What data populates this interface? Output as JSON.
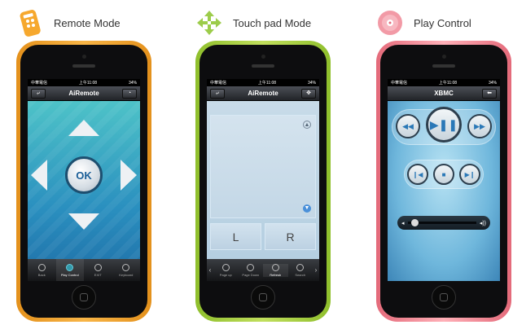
{
  "captions": {
    "remote": "Remote Mode",
    "touchpad": "Touch pad Mode",
    "play": "Play Control"
  },
  "status": {
    "carrier": "中華電信",
    "time": "上午11:08",
    "battery": "34%"
  },
  "remote": {
    "title": "AiRemote",
    "ok_label": "OK",
    "tabs": [
      {
        "label": "Back"
      },
      {
        "label": "Play Control"
      },
      {
        "label": "EXIT"
      },
      {
        "label": "Keyboard"
      }
    ]
  },
  "touchpad": {
    "title": "AiRemote",
    "left_label": "L",
    "right_label": "R",
    "tabs": [
      {
        "label": "Page up"
      },
      {
        "label": "Page Down"
      },
      {
        "label": "Refresh"
      },
      {
        "label": "Search"
      }
    ]
  },
  "play": {
    "title": "XBMC",
    "volume_level": 0.05
  },
  "colors": {
    "accent": "#2a78b7",
    "orange": "#f8b547",
    "green": "#c1df5d",
    "red": "#ffb0b8"
  }
}
